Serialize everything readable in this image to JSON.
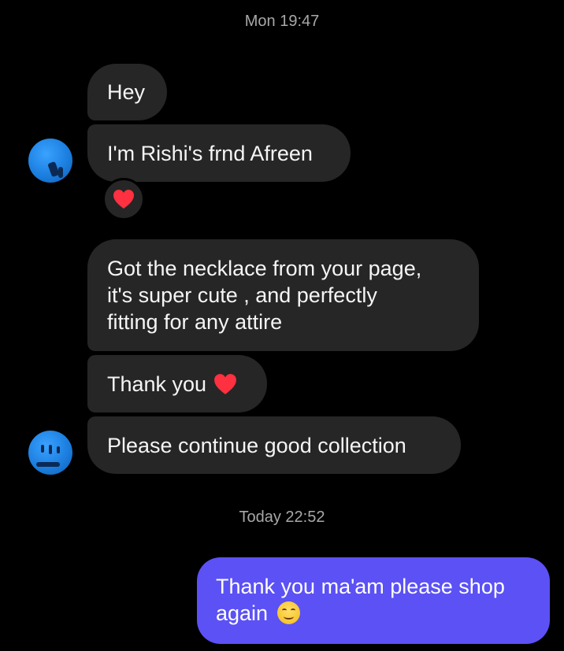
{
  "thread": {
    "timestamp_1": "Mon 19:47",
    "timestamp_2": "Today 22:52"
  },
  "received": {
    "msg_hey": "Hey",
    "msg_intro": "I'm Rishi's frnd Afreen",
    "msg_review_line1": "Got the necklace from your page,",
    "msg_review_line2": "it's super cute , and perfectly",
    "msg_review_line3": "fitting for any attire",
    "msg_thanks": "Thank you",
    "msg_continue": "Please continue good collection"
  },
  "sent": {
    "msg_reply_line1": "Thank you ma'am please shop",
    "msg_reply_line2": "again"
  },
  "icons": {
    "reaction": "heart-emoji",
    "thanks_emoji": "heart-emoji",
    "reply_emoji": "smiling-face-emoji",
    "avatar": "profile-avatar"
  },
  "colors": {
    "background": "#000000",
    "received_bubble": "#262626",
    "sent_bubble": "#5b51f5",
    "timestamp_text": "#a8a8a8",
    "heart": "#ff3040",
    "avatar": "#1c7fe0"
  }
}
